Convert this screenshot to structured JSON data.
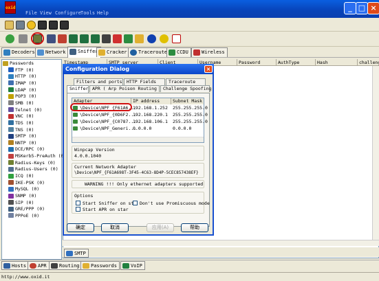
{
  "app": {
    "logo_text": "oxid",
    "menu": [
      "File",
      "View",
      "Configure",
      "Tools",
      "Help"
    ]
  },
  "main_tabs": [
    "Decoders",
    "Network",
    "Sniffer",
    "Cracker",
    "Traceroute",
    "CCDU",
    "Wireless"
  ],
  "tree": [
    "Passwords",
    "FTP (0)",
    "HTTP (0)",
    "IMAP (0)",
    "LDAP (0)",
    "POP3 (0)",
    "SMB (0)",
    "Telnet (0)",
    "VNC (0)",
    "TDS (0)",
    "TNS (0)",
    "SMTP (0)",
    "NNTP (0)",
    "DCE/RPC (0)",
    "MSKerb5-PreAuth (0)",
    "Radius-Keys (0)",
    "Radius-Users (0)",
    "ICQ (0)",
    "IKE-PSK (0)",
    "MySQL (0)",
    "SNMP (0)",
    "SIP (0)",
    "GRE/PPP (0)",
    "PPPoE (0)"
  ],
  "grid_headers": [
    "Timestamp",
    "SMTP server",
    "Client",
    "Username",
    "Password",
    "AuthType",
    "Hash",
    "challeng"
  ],
  "sub_tab": "SMTP",
  "bottom_tabs": [
    "Hosts",
    "APR",
    "Routing",
    "Passwords",
    "VoIP"
  ],
  "status_url": "http://www.oxid.it",
  "dialog": {
    "title": "Configuration Dialog",
    "tabs_row1": [
      "Filters and ports",
      "HTTP Fields",
      "Traceroute"
    ],
    "tabs_row2": [
      "Sniffer",
      "APR ( Arp Poison Routing )",
      "Challenge Spoofing"
    ],
    "adapter_headers": [
      "Adapter",
      "IP address",
      "Subnet Mask"
    ],
    "adapters": [
      {
        "name": "\\Device\\NPF_{F61A6...",
        "ip": "192.168.1.252",
        "mask": "255.255.255.0"
      },
      {
        "name": "\\Device\\NPF_{0D6F2...",
        "ip": "192.168.220.1",
        "mask": "255.255.255.0"
      },
      {
        "name": "\\Device\\NPF_{C0787...",
        "ip": "192.168.106.1",
        "mask": "255.255.255.0"
      },
      {
        "name": "\\Device\\NPF_Generi...",
        "ip": "0.0.0.0",
        "mask": "0.0.0.0"
      }
    ],
    "winpcap_label": "Winpcap Version",
    "winpcap_version": "4.0.0.1040",
    "current_adapter_label": "Current Network Adapter",
    "current_adapter": "\\Device\\NPF_{F61A698T-3F45-4C63-8D4P-5CEC857438EF}",
    "warning": "WARNING !!! Only ethernet adapters supported",
    "options_label": "Options",
    "opt_start_sniffer": "Start Sniffer on st",
    "opt_no_promiscuous": "Don't use Promiscuous mode",
    "opt_start_apr": "Start APR on star",
    "buttons": {
      "ok": "确定",
      "cancel": "取消",
      "apply": "应用(A)",
      "help": "帮助"
    }
  },
  "colors": {
    "titlebar": "#0843b8",
    "highlight": "#d01010"
  }
}
